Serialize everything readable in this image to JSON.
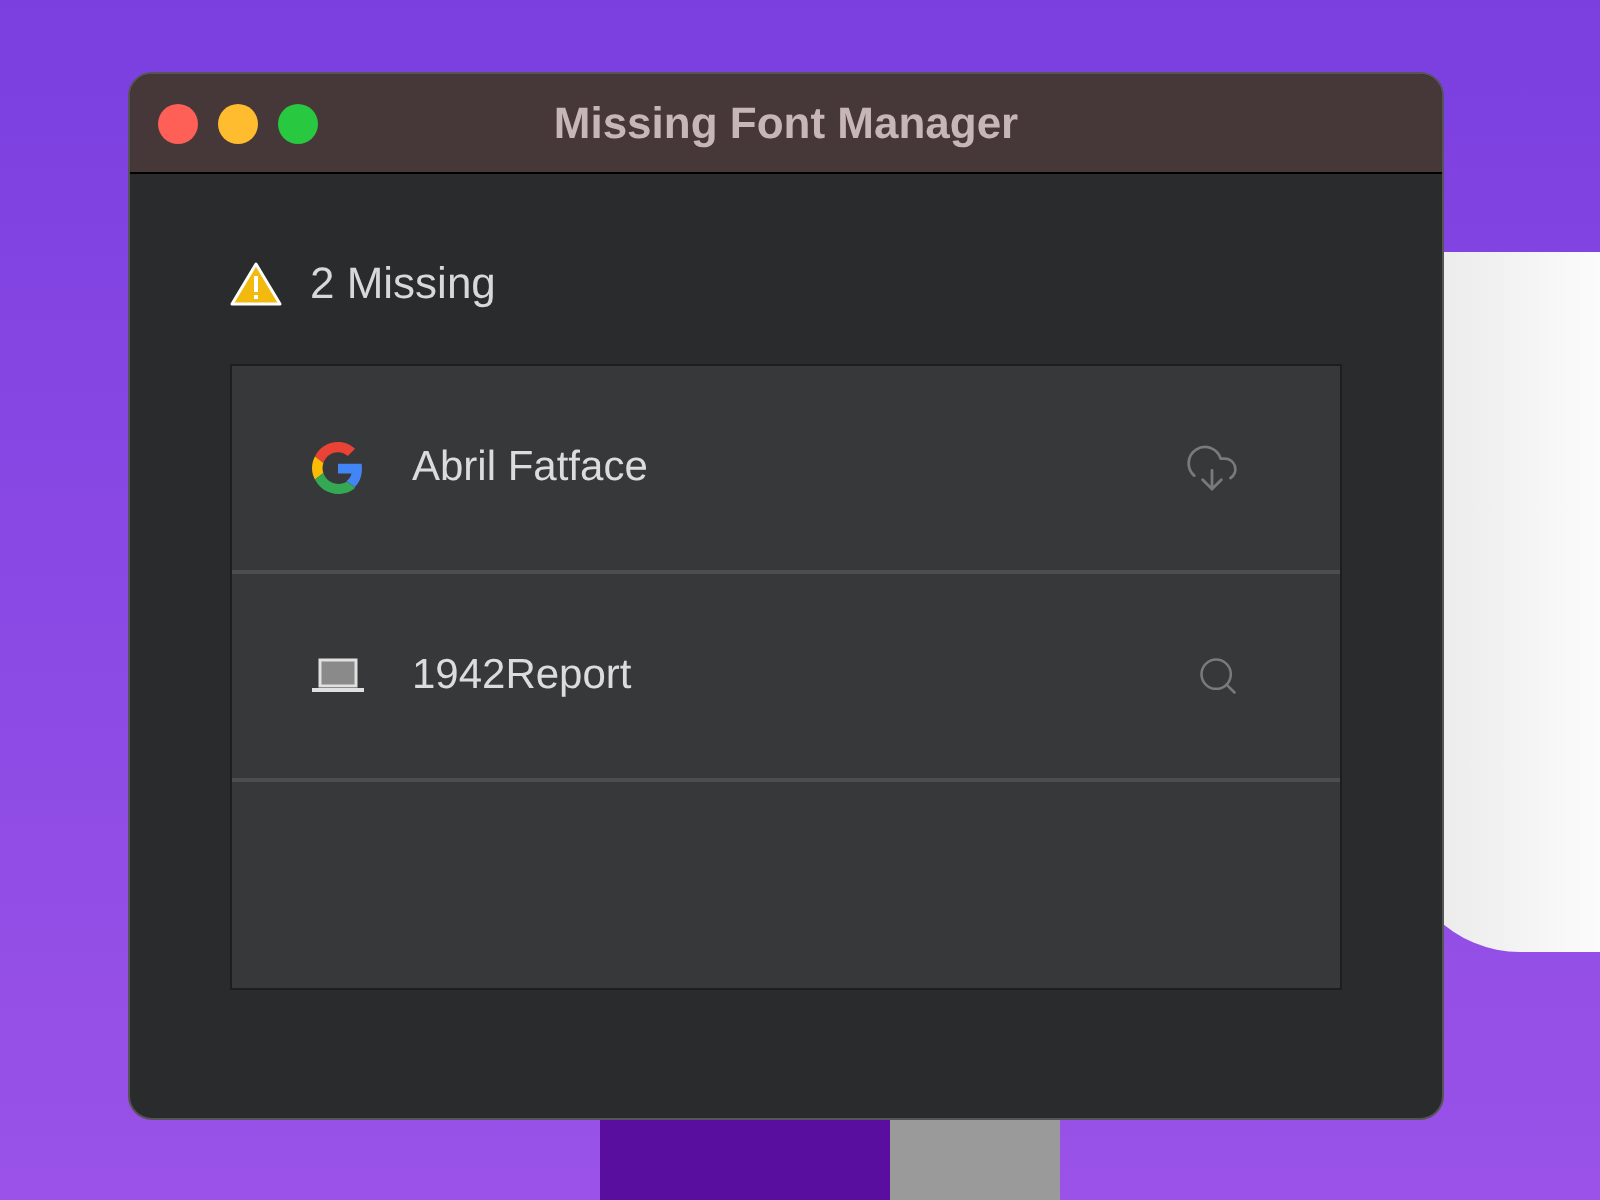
{
  "window": {
    "title": "Missing Font Manager"
  },
  "summary": "2 Missing",
  "fonts": [
    {
      "name": "Abril Fatface",
      "kind": "google",
      "action": {
        "kind": "download"
      }
    },
    {
      "name": "1942Report",
      "kind": "local",
      "action": {
        "kind": "search"
      }
    }
  ]
}
